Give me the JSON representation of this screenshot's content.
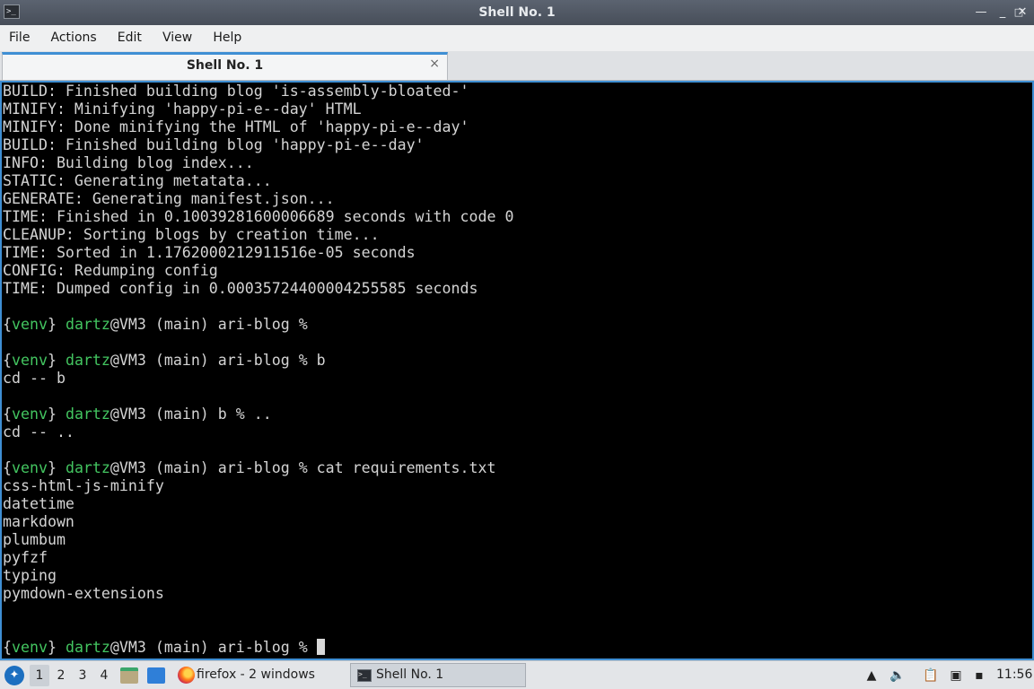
{
  "window": {
    "title": "Shell No. 1"
  },
  "menu": [
    "File",
    "Actions",
    "Edit",
    "View",
    "Help"
  ],
  "tab": {
    "label": "Shell No. 1",
    "close": "×"
  },
  "titlebar_buttons": {
    "shade": "—",
    "minimize": "_",
    "maximize": "□",
    "close": "✕"
  },
  "terminal": {
    "lines": [
      [
        {
          "t": "BUILD: Finished building blog 'is-assembly-bloated-'"
        }
      ],
      [
        {
          "t": "MINIFY: Minifying 'happy-pi-e--day' HTML"
        }
      ],
      [
        {
          "t": "MINIFY: Done minifying the HTML of 'happy-pi-e--day'"
        }
      ],
      [
        {
          "t": "BUILD: Finished building blog 'happy-pi-e--day'"
        }
      ],
      [
        {
          "t": "INFO: Building blog index..."
        }
      ],
      [
        {
          "t": "STATIC: Generating metatata..."
        }
      ],
      [
        {
          "t": "GENERATE: Generating manifest.json..."
        }
      ],
      [
        {
          "t": "TIME: Finished in 0.10039281600006689 seconds with code 0"
        }
      ],
      [
        {
          "t": "CLEANUP: Sorting blogs by creation time..."
        }
      ],
      [
        {
          "t": "TIME: Sorted in 1.1762000212911516e-05 seconds"
        }
      ],
      [
        {
          "t": "CONFIG: Redumping config"
        }
      ],
      [
        {
          "t": "TIME: Dumped config in 0.00035724400004255585 seconds"
        }
      ],
      [],
      [
        {
          "t": "{"
        },
        {
          "t": "venv",
          "c": "green"
        },
        {
          "t": "} "
        },
        {
          "t": "dartz",
          "c": "green"
        },
        {
          "t": "@VM3 (main) ari-blog %"
        }
      ],
      [],
      [
        {
          "t": "{"
        },
        {
          "t": "venv",
          "c": "green"
        },
        {
          "t": "} "
        },
        {
          "t": "dartz",
          "c": "green"
        },
        {
          "t": "@VM3 (main) ari-blog % b"
        }
      ],
      [
        {
          "t": "cd -- b"
        }
      ],
      [],
      [
        {
          "t": "{"
        },
        {
          "t": "venv",
          "c": "green"
        },
        {
          "t": "} "
        },
        {
          "t": "dartz",
          "c": "green"
        },
        {
          "t": "@VM3 (main) b % .."
        }
      ],
      [
        {
          "t": "cd -- .."
        }
      ],
      [],
      [
        {
          "t": "{"
        },
        {
          "t": "venv",
          "c": "green"
        },
        {
          "t": "} "
        },
        {
          "t": "dartz",
          "c": "green"
        },
        {
          "t": "@VM3 (main) ari-blog % cat requirements.txt"
        }
      ],
      [
        {
          "t": "css-html-js-minify"
        }
      ],
      [
        {
          "t": "datetime"
        }
      ],
      [
        {
          "t": "markdown"
        }
      ],
      [
        {
          "t": "plumbum"
        }
      ],
      [
        {
          "t": "pyfzf"
        }
      ],
      [
        {
          "t": "typing"
        }
      ],
      [
        {
          "t": "pymdown-extensions"
        }
      ],
      [],
      [],
      [
        {
          "t": "{"
        },
        {
          "t": "venv",
          "c": "green"
        },
        {
          "t": "} "
        },
        {
          "t": "dartz",
          "c": "green"
        },
        {
          "t": "@VM3 (main) ari-blog % "
        }
      ]
    ]
  },
  "taskbar": {
    "desktops": [
      "1",
      "2",
      "3",
      "4"
    ],
    "firefox_label": "firefox - 2 windows",
    "shell_label": "Shell No. 1",
    "clock": "11:56"
  },
  "icons": [
    "start-menu-icon",
    "file-manager-icon",
    "show-desktop-icon",
    "firefox-icon",
    "terminal-icon",
    "tray-up-icon",
    "volume-icon",
    "clipboard-icon",
    "network-icon",
    "notification-icon"
  ]
}
